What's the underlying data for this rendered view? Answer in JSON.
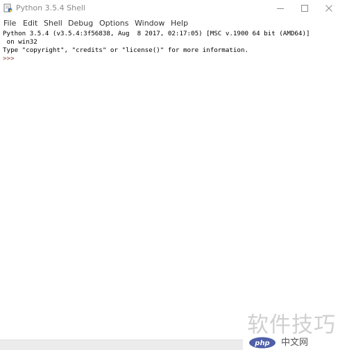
{
  "window": {
    "title": "Python 3.5.4 Shell",
    "app_icon": "python-idle-icon",
    "controls": [
      "minimize-icon",
      "maximize-icon",
      "close-icon"
    ]
  },
  "menu": {
    "items": [
      {
        "label": "File"
      },
      {
        "label": "Edit"
      },
      {
        "label": "Shell"
      },
      {
        "label": "Debug"
      },
      {
        "label": "Options"
      },
      {
        "label": "Window"
      },
      {
        "label": "Help"
      }
    ]
  },
  "shell": {
    "lines": [
      "Python 3.5.4 (v3.5.4:3f56838, Aug  8 2017, 02:17:05) [MSC v.1900 64 bit (AMD64)]",
      " on win32",
      "Type \"copyright\", \"credits\" or \"license()\" for more information."
    ],
    "prompt": ">>>"
  },
  "watermark": {
    "text": "软件技巧",
    "logo_text": "php",
    "site": "中文网"
  },
  "colors": {
    "prompt": "#8a3c3c",
    "title_text": "#8a8a8a",
    "watermark_logo": "#4f5fa8"
  }
}
